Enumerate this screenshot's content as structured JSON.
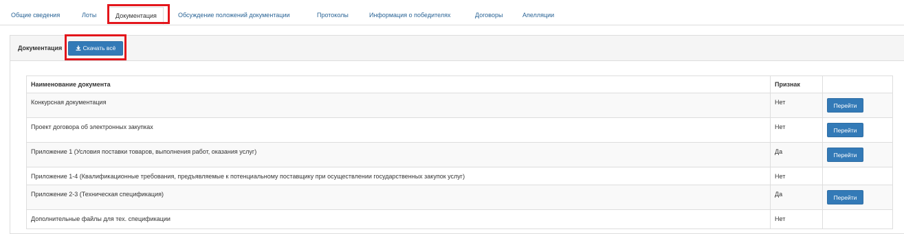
{
  "tabs": [
    {
      "label": "Общие сведения"
    },
    {
      "label": "Лоты"
    },
    {
      "label": "Документация"
    },
    {
      "label": "Обсуждение положений документации"
    },
    {
      "label": "Протоколы"
    },
    {
      "label": "Информация о победителях"
    },
    {
      "label": "Договоры"
    },
    {
      "label": "Апелляции"
    }
  ],
  "active_tab": "Документация",
  "panel": {
    "title": "Документация",
    "download_all_label": "Скачать всё",
    "download_icon": "download-icon"
  },
  "table": {
    "headers": [
      "Наименование документа",
      "Признак",
      ""
    ],
    "rows": [
      {
        "name": "Конкурсная документация",
        "flag": "Нет",
        "action": "Перейти"
      },
      {
        "name": "Проект договора об электронных закупках",
        "flag": "Нет",
        "action": "Перейти"
      },
      {
        "name": "Приложение 1 (Условия поставки товаров, выполнения работ, оказания услуг)",
        "flag": "Да",
        "action": "Перейти"
      },
      {
        "name": "Приложение 1-4 (Квалификационные требования, предъявляемые к потенциальному поставщику при осуществлении государственных закупок услуг)",
        "flag": "Нет",
        "action": ""
      },
      {
        "name": "Приложение 2-3 (Техническая спецификация)",
        "flag": "Да",
        "action": "Перейти"
      },
      {
        "name": "Дополнительные файлы для тех. спецификации",
        "flag": "Нет",
        "action": ""
      }
    ]
  },
  "colors": {
    "primary_button": "#337ab7",
    "highlight_box": "#e3151b",
    "tab_link": "#2a6496"
  }
}
